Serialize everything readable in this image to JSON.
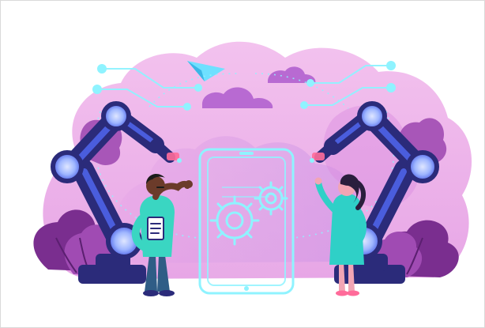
{
  "image": {
    "subject": "robotic-arms-with-tablet-and-two-engineers",
    "colors": {
      "frame_border": "#d9d9d9",
      "blob_light": "#f2b9ea",
      "blob_mid": "#d98be0",
      "blob_deep": "#b56ad8",
      "robot_dark": "#2b2b7a",
      "robot_blue": "#4e63e8",
      "robot_glow": "#9fb6ff",
      "circuit_line": "#8ff3ff",
      "leaf_dark": "#7a2e8f",
      "leaf_mid": "#a04bb3",
      "skin_man": "#6b3b2a",
      "shirt_man": "#3ad6c2",
      "pants_man": "#2f5d86",
      "dress_woman": "#2fd0c7",
      "hair_woman": "#2a1e3d"
    },
    "icons": [
      "paper-plane-icon",
      "cloud-icon",
      "tablet-icon",
      "gear-icon",
      "robot-arm-icon",
      "leaf-icon",
      "engineer-man-figure",
      "engineer-woman-figure"
    ]
  }
}
